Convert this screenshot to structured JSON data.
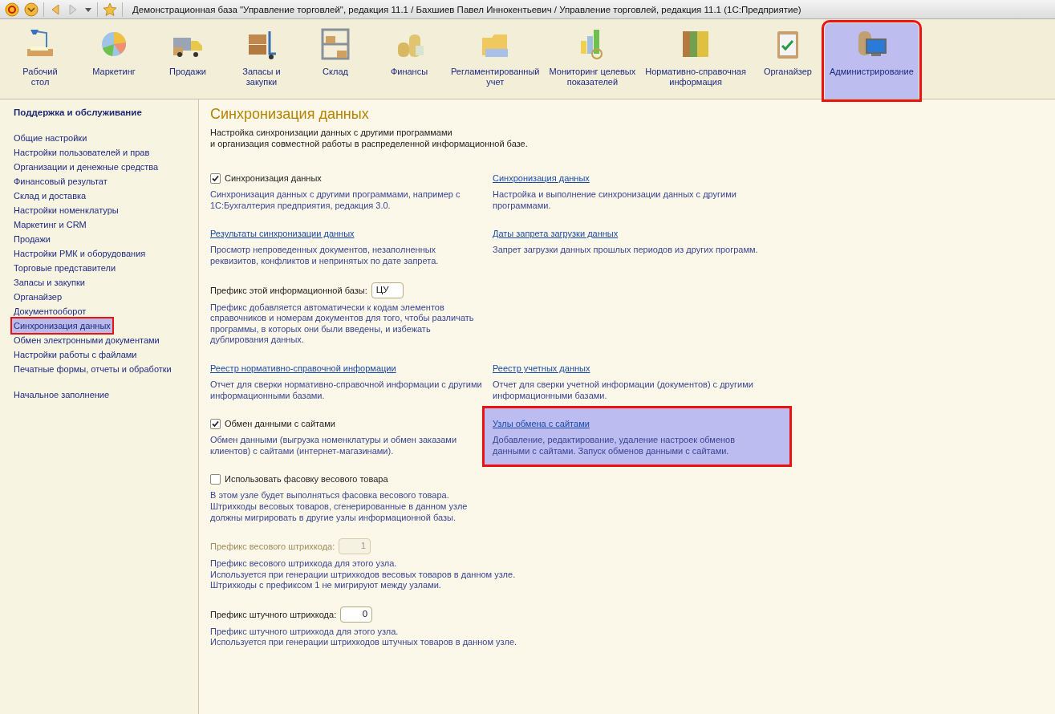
{
  "window": {
    "title": "Демонстрационная база \"Управление торговлей\", редакция 11.1 / Бахшиев Павел Иннокентьевич / Управление торговлей, редакция 11.1  (1С:Предприятие)"
  },
  "sections": [
    {
      "label": "Рабочий\nстол",
      "selected": false,
      "annotated": false
    },
    {
      "label": "Маркетинг",
      "selected": false,
      "annotated": false
    },
    {
      "label": "Продажи",
      "selected": false,
      "annotated": false
    },
    {
      "label": "Запасы и\nзакупки",
      "selected": false,
      "annotated": false
    },
    {
      "label": "Склад",
      "selected": false,
      "annotated": false
    },
    {
      "label": "Финансы",
      "selected": false,
      "annotated": false
    },
    {
      "label": "Регламентированный\nучет",
      "selected": false,
      "annotated": false
    },
    {
      "label": "Мониторинг целевых\nпоказателей",
      "selected": false,
      "annotated": false
    },
    {
      "label": "Нормативно-справочная\nинформация",
      "selected": false,
      "annotated": false
    },
    {
      "label": "Органайзер",
      "selected": false,
      "annotated": false
    },
    {
      "label": "Администрирование",
      "selected": true,
      "annotated": true
    }
  ],
  "sidebar": {
    "title": "Поддержка и обслуживание",
    "items": [
      {
        "label": "Общие настройки",
        "selected": false,
        "annotated": false
      },
      {
        "label": "Настройки пользователей и прав",
        "selected": false,
        "annotated": false
      },
      {
        "label": "Организации и денежные средства",
        "selected": false,
        "annotated": false
      },
      {
        "label": "Финансовый результат",
        "selected": false,
        "annotated": false
      },
      {
        "label": "Склад и доставка",
        "selected": false,
        "annotated": false
      },
      {
        "label": "Настройки номенклатуры",
        "selected": false,
        "annotated": false
      },
      {
        "label": "Маркетинг и CRM",
        "selected": false,
        "annotated": false
      },
      {
        "label": "Продажи",
        "selected": false,
        "annotated": false
      },
      {
        "label": "Настройки РМК и оборудования",
        "selected": false,
        "annotated": false
      },
      {
        "label": "Торговые представители",
        "selected": false,
        "annotated": false
      },
      {
        "label": "Запасы и закупки",
        "selected": false,
        "annotated": false
      },
      {
        "label": "Органайзер",
        "selected": false,
        "annotated": false
      },
      {
        "label": "Документооборот",
        "selected": false,
        "annotated": false
      },
      {
        "label": "Синхронизация данных",
        "selected": true,
        "annotated": true
      },
      {
        "label": "Обмен электронными документами",
        "selected": false,
        "annotated": false
      },
      {
        "label": "Настройки работы с файлами",
        "selected": false,
        "annotated": false
      },
      {
        "label": "Печатные формы, отчеты и обработки",
        "selected": false,
        "annotated": false
      }
    ],
    "extra_items": [
      {
        "label": "Начальное заполнение",
        "selected": false
      }
    ]
  },
  "content": {
    "title": "Синхронизация данных",
    "description": "Настройка синхронизации данных с другими программами\nи организация совместной работы в распределенной информационной базе.",
    "rows": [
      {
        "left": {
          "kind": "checkbox",
          "label": "Синхронизация данных",
          "checked": true,
          "description": "Синхронизация данных с другими программами, например с\n1С:Бухгалтерия предприятия, редакция 3.0."
        },
        "right": {
          "kind": "link",
          "label": "Синхронизация данных",
          "annotated": false,
          "description": "Настройка и выполнение синхронизации данных с другими\nпрограммами."
        }
      },
      {
        "left": {
          "kind": "link",
          "label": "Результаты синхронизации данных",
          "annotated": false,
          "description": "Просмотр непроведенных документов, незаполненных\nреквизитов, конфликтов и непринятых по дате запрета."
        },
        "right": {
          "kind": "link",
          "label": "Даты запрета загрузки данных",
          "annotated": false,
          "description": "Запрет загрузки данных прошлых периодов из других программ."
        }
      },
      {
        "left": {
          "kind": "field",
          "label": "Префикс этой информационной базы:",
          "value": "ЦУ",
          "disabled": false,
          "description": "Префикс добавляется автоматически к кодам элементов\nсправочников и номерам документов для того, чтобы различать\nпрограммы, в которых они были введены, и избежать\nдублирования данных."
        }
      },
      {
        "left": {
          "kind": "link",
          "label": "Реестр нормативно-справочной информации",
          "annotated": false,
          "description": "Отчет для сверки нормативно-справочной информации с другими\nинформационными базами."
        },
        "right": {
          "kind": "link",
          "label": "Реестр учетных данных",
          "annotated": false,
          "description": "Отчет для сверки учетной информации (документов) с другими\nинформационными базами."
        }
      },
      {
        "left": {
          "kind": "checkbox",
          "label": "Обмен данными с сайтами",
          "checked": true,
          "description": "Обмен данными (выгрузка номенклатуры и обмен заказами\nклиентов) с сайтами (интернет-магазинами)."
        },
        "right": {
          "kind": "link",
          "label": "Узлы обмена с сайтами",
          "annotated": true,
          "description": "Добавление, редактирование, удаление настроек обменов\nданными с сайтами. Запуск обменов данными с сайтами."
        }
      },
      {
        "left": {
          "kind": "checkbox",
          "label": "Использовать фасовку весового товара",
          "checked": false,
          "description": "В этом узле будет выполняться фасовка весового товара.\nШтрихкоды весовых товаров, сгенерированные в данном узле\nдолжны мигрировать в другие узлы информационной базы."
        }
      },
      {
        "left": {
          "kind": "number",
          "label": "Префикс весового штрихкода:",
          "value": "1",
          "disabled": true,
          "description": "Префикс весового штрихкода для этого узла.\nИспользуется при генерации штрихкодов весовых товаров в данном узле.\nШтрихкоды с префиксом 1 не мигрируют между узлами."
        }
      },
      {
        "left": {
          "kind": "number",
          "label": "Префикс штучного штрихкода:",
          "value": "0",
          "disabled": false,
          "description": "Префикс штучного штрихкода для этого узла.\nИспользуется при генерации штрихкодов штучных товаров в данном узле."
        }
      }
    ]
  }
}
